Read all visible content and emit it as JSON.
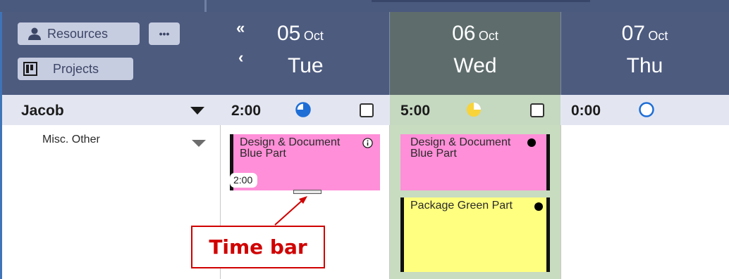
{
  "toolbar": {
    "resources_label": "Resources",
    "more_label": "•••",
    "projects_label": "Projects"
  },
  "days": [
    {
      "num": "05",
      "month": "Oct",
      "name": "Tue"
    },
    {
      "num": "06",
      "month": "Oct",
      "name": "Wed"
    },
    {
      "num": "07",
      "month": "Oct",
      "name": "Thu"
    }
  ],
  "nav": {
    "first": "«",
    "prev": "‹"
  },
  "resource": {
    "name": "Jacob",
    "subrow": "Misc. Other",
    "totals": [
      "2:00",
      "5:00",
      "0:00"
    ]
  },
  "tasks": [
    {
      "title": "Design & Document Blue Part",
      "time": "2:00",
      "color": "#ff8fd8"
    },
    {
      "title": "Design & Document Blue Part",
      "color": "#ff8fd8"
    },
    {
      "title": "Package Green Part",
      "color": "#ffff80"
    }
  ],
  "annotation": {
    "label": "Time bar",
    "color": "#d00000"
  },
  "colors": {
    "header": "#4d5b7f",
    "today_header": "#5e6c6c",
    "today_column": "#c8dcc0",
    "row_bar": "#e3e6f1",
    "accent_blue": "#1e6ed6",
    "load_yellow": "#f8d33a"
  }
}
